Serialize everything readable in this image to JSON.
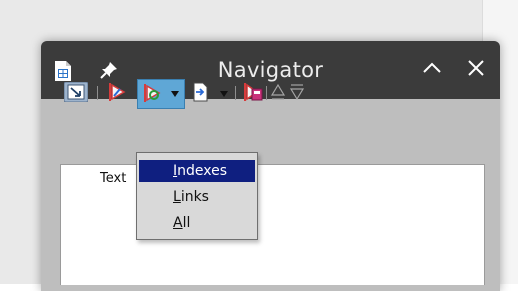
{
  "dialog": {
    "title": "Navigator"
  },
  "tree": {
    "first_item": "Text"
  },
  "dropdown": {
    "items": [
      {
        "accel": "I",
        "rest": "ndexes",
        "selected": true
      },
      {
        "accel": "L",
        "rest": "inks",
        "selected": false
      },
      {
        "accel": "A",
        "rest": "ll",
        "selected": false
      }
    ]
  },
  "icons": {
    "toggle": "content-view-toggle-icon",
    "prev": "previous-object-icon",
    "next": "next-object-icon",
    "drag": "drag-mode-icon",
    "regions": "reminder-icon",
    "promote": "promote-icon",
    "demote": "demote-icon"
  },
  "colors": {
    "titlebar": "#3b3b3b",
    "dialog_bg": "#bebebe",
    "menu_highlight": "#0f1f80"
  }
}
